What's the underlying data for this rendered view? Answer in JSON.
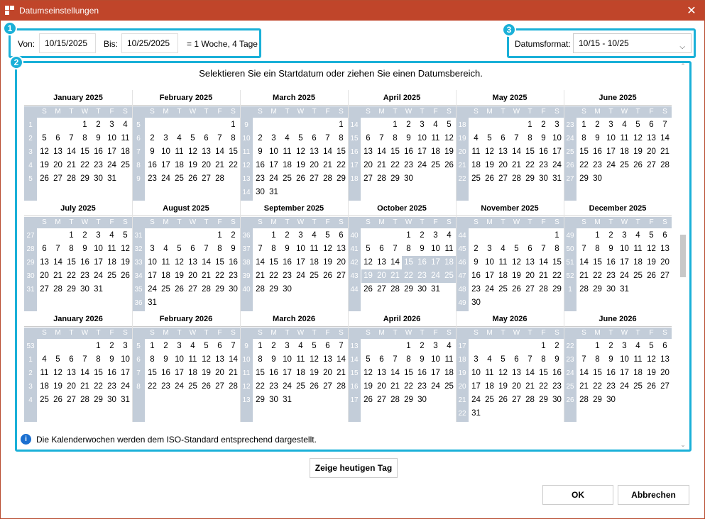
{
  "window": {
    "title": "Datumseinstellungen",
    "close_glyph": "✕"
  },
  "range": {
    "from_label": "Von:",
    "from_value": "10/15/2025",
    "to_label": "Bis:",
    "to_value": "10/25/2025",
    "duration": "= 1 Woche, 4 Tage"
  },
  "format": {
    "label": "Datumsformat:",
    "value": "10/15 - 10/25"
  },
  "badges": [
    "1",
    "2",
    "3"
  ],
  "instruction": "Selektieren Sie ein Startdatum oder ziehen Sie einen Datumsbereich.",
  "weekday_headers": [
    "S",
    "M",
    "T",
    "W",
    "T",
    "F",
    "S"
  ],
  "months": [
    {
      "name": "January 2025",
      "start": 3,
      "days": 31,
      "weeks": [
        "1",
        "2",
        "3",
        "4",
        "5"
      ]
    },
    {
      "name": "February 2025",
      "start": 6,
      "days": 28,
      "weeks": [
        "5",
        "6",
        "7",
        "8",
        "9"
      ]
    },
    {
      "name": "March 2025",
      "start": 6,
      "days": 31,
      "weeks": [
        "9",
        "10",
        "11",
        "12",
        "13",
        "14"
      ]
    },
    {
      "name": "April 2025",
      "start": 2,
      "days": 30,
      "weeks": [
        "14",
        "15",
        "16",
        "17",
        "18"
      ]
    },
    {
      "name": "May 2025",
      "start": 4,
      "days": 31,
      "weeks": [
        "18",
        "19",
        "20",
        "21",
        "22"
      ]
    },
    {
      "name": "June 2025",
      "start": 0,
      "days": 30,
      "weeks": [
        "23",
        "24",
        "25",
        "26",
        "27"
      ]
    },
    {
      "name": "July 2025",
      "start": 2,
      "days": 31,
      "weeks": [
        "27",
        "28",
        "29",
        "30",
        "31"
      ]
    },
    {
      "name": "August 2025",
      "start": 5,
      "days": 31,
      "weeks": [
        "31",
        "32",
        "33",
        "34",
        "35",
        "36"
      ]
    },
    {
      "name": "September 2025",
      "start": 1,
      "days": 30,
      "weeks": [
        "36",
        "37",
        "38",
        "39",
        "40"
      ]
    },
    {
      "name": "October 2025",
      "start": 3,
      "days": 31,
      "weeks": [
        "40",
        "41",
        "42",
        "43",
        "44"
      ],
      "selected": [
        15,
        25
      ]
    },
    {
      "name": "November 2025",
      "start": 6,
      "days": 30,
      "weeks": [
        "44",
        "45",
        "46",
        "47",
        "48",
        "49"
      ]
    },
    {
      "name": "December 2025",
      "start": 1,
      "days": 31,
      "weeks": [
        "49",
        "50",
        "51",
        "52",
        "1"
      ]
    },
    {
      "name": "January 2026",
      "start": 4,
      "days": 31,
      "weeks": [
        "53",
        "1",
        "2",
        "3",
        "4"
      ]
    },
    {
      "name": "February 2026",
      "start": 0,
      "days": 28,
      "weeks": [
        "5",
        "6",
        "7",
        "8"
      ]
    },
    {
      "name": "March 2026",
      "start": 0,
      "days": 31,
      "weeks": [
        "9",
        "10",
        "11",
        "12",
        "13"
      ]
    },
    {
      "name": "April 2026",
      "start": 3,
      "days": 30,
      "weeks": [
        "13",
        "14",
        "15",
        "16",
        "17"
      ]
    },
    {
      "name": "May 2026",
      "start": 5,
      "days": 31,
      "weeks": [
        "17",
        "18",
        "19",
        "20",
        "21",
        "22"
      ]
    },
    {
      "name": "June 2026",
      "start": 1,
      "days": 30,
      "weeks": [
        "22",
        "23",
        "24",
        "25",
        "26"
      ]
    }
  ],
  "info_text": "Die Kalenderwochen werden dem ISO-Standard entsprechend dargestellt.",
  "today_button": "Zeige heutigen Tag",
  "ok_button": "OK",
  "cancel_button": "Abbrechen",
  "colors": {
    "accent": "#1ab0d8",
    "titlebar": "#c0452a",
    "calendar_band": "#c3cdd9"
  }
}
